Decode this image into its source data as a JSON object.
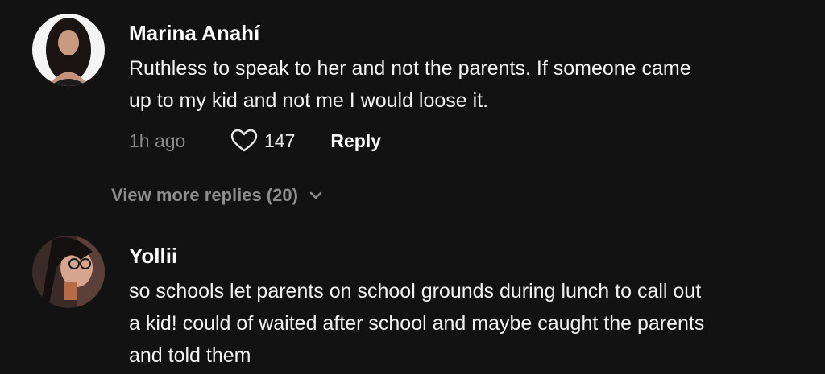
{
  "comments": [
    {
      "username": "Marina Anahí",
      "text_lines": [
        "Ruthless to speak to her and not the parents. If someone came",
        "up to my kid and not me I would loose it."
      ],
      "time": "1h ago",
      "likes": "147",
      "reply_label": "Reply",
      "avatar_icon": "user-avatar-photo"
    },
    {
      "username": "Yollii",
      "text_lines": [
        "so schools let parents on school grounds during lunch to call out",
        "a kid! could of waited after school and maybe caught the parents",
        "and told them"
      ],
      "avatar_icon": "user-avatar-photo"
    }
  ],
  "view_more": {
    "label": "View more replies (20)",
    "icon": "chevron-down-icon"
  },
  "colors": {
    "background": "#121212",
    "text": "#ffffff",
    "muted": "#8a8a8a"
  }
}
